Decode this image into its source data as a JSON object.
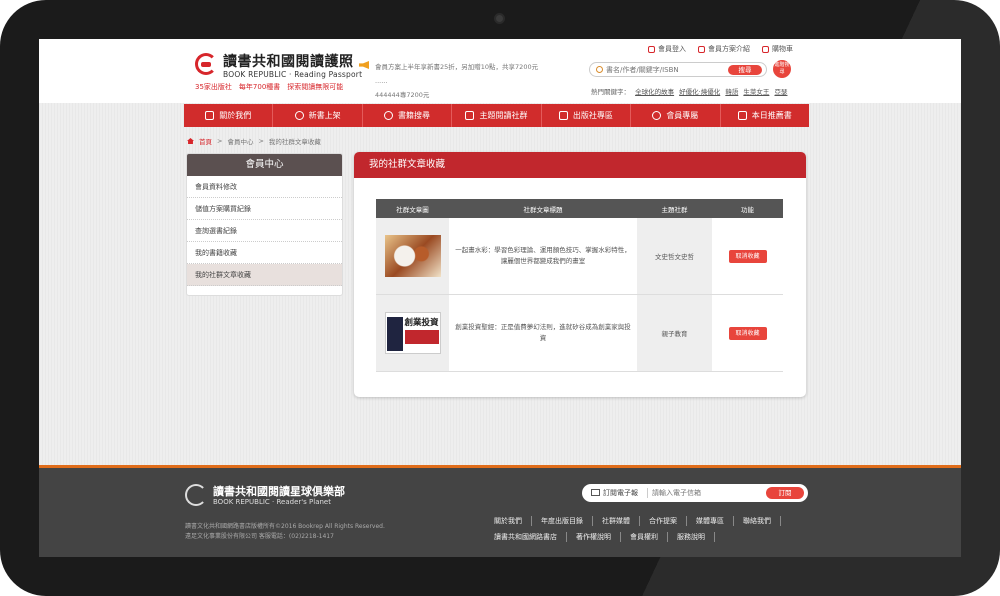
{
  "header": {
    "logo_cn": "讀書共和國閱讀護照",
    "logo_en": "BOOK REPUBLIC · Reading Passport",
    "logo_sub": "35家出版社　每年700種書　探索閱讀無限可能",
    "notice": "會員方案上半年享新書25折，另加贈10點，共享7200元 ......",
    "notice_line2": "444444專7200元",
    "top_links": [
      "會員登入",
      "會員方案介紹",
      "購物車"
    ],
    "search_placeholder": "書名/作者/關鍵字/ISBN",
    "search_button": "搜尋",
    "advanced_search": "進階搜尋",
    "hot_label": "熱門關鍵字：",
    "hot_keywords": [
      "全球化的故事",
      "好優化·燒優化",
      "韓語",
      "生菜女王",
      "亞瑟"
    ]
  },
  "nav": [
    "關於我們",
    "新書上架",
    "書籍搜尋",
    "主題閱讀社群",
    "出版社專區",
    "會員專屬",
    "本日推薦書"
  ],
  "breadcrumb": [
    "首頁",
    "會員中心",
    "我的社群文章收藏"
  ],
  "sidebar": {
    "title": "會員中心",
    "items": [
      "會員資料修改",
      "儲值方案購買紀錄",
      "查詢選書紀錄",
      "我的書籍收藏",
      "我的社群文章收藏"
    ]
  },
  "panel": {
    "title": "我的社群文章收藏",
    "columns": [
      "社群文章圖",
      "社群文章標題",
      "主題社群",
      "功能"
    ],
    "rows": [
      {
        "title": "一起畫水彩：學習色彩理論、運用顏色技巧、掌握水彩特性，讓麗個世界都變成我們的畫室",
        "community": "文史哲文史哲",
        "action": "取消收藏"
      },
      {
        "title": "創業投資聖經：正是值費夢幻法則，進就矽谷成為創業家與投資",
        "community": "親子教育",
        "action": "取消收藏",
        "thumb_text": "創業投資"
      }
    ]
  },
  "footer": {
    "logo_cn": "讀書共和國閱讀星球俱樂部",
    "logo_en": "BOOK REPUBLIC · Reader's Planet",
    "copyright_1": "讀書文化共和國網路書店版權所有©2016 Bookrep All Rights Reserved.",
    "copyright_2": "遠足文化事業股份有限公司 客服電話：(02)2218-1417",
    "subscribe_label": "訂閱電子報",
    "subscribe_placeholder": "請輸入電子信箱",
    "subscribe_button": "訂閱",
    "links_row1": [
      "關於我們",
      "年度出版目錄",
      "社群媒體",
      "合作提案",
      "媒體專區",
      "聯絡我們"
    ],
    "links_row2": [
      "讀書共和國網路書店",
      "著作權說明",
      "會員權利",
      "服務說明"
    ]
  }
}
